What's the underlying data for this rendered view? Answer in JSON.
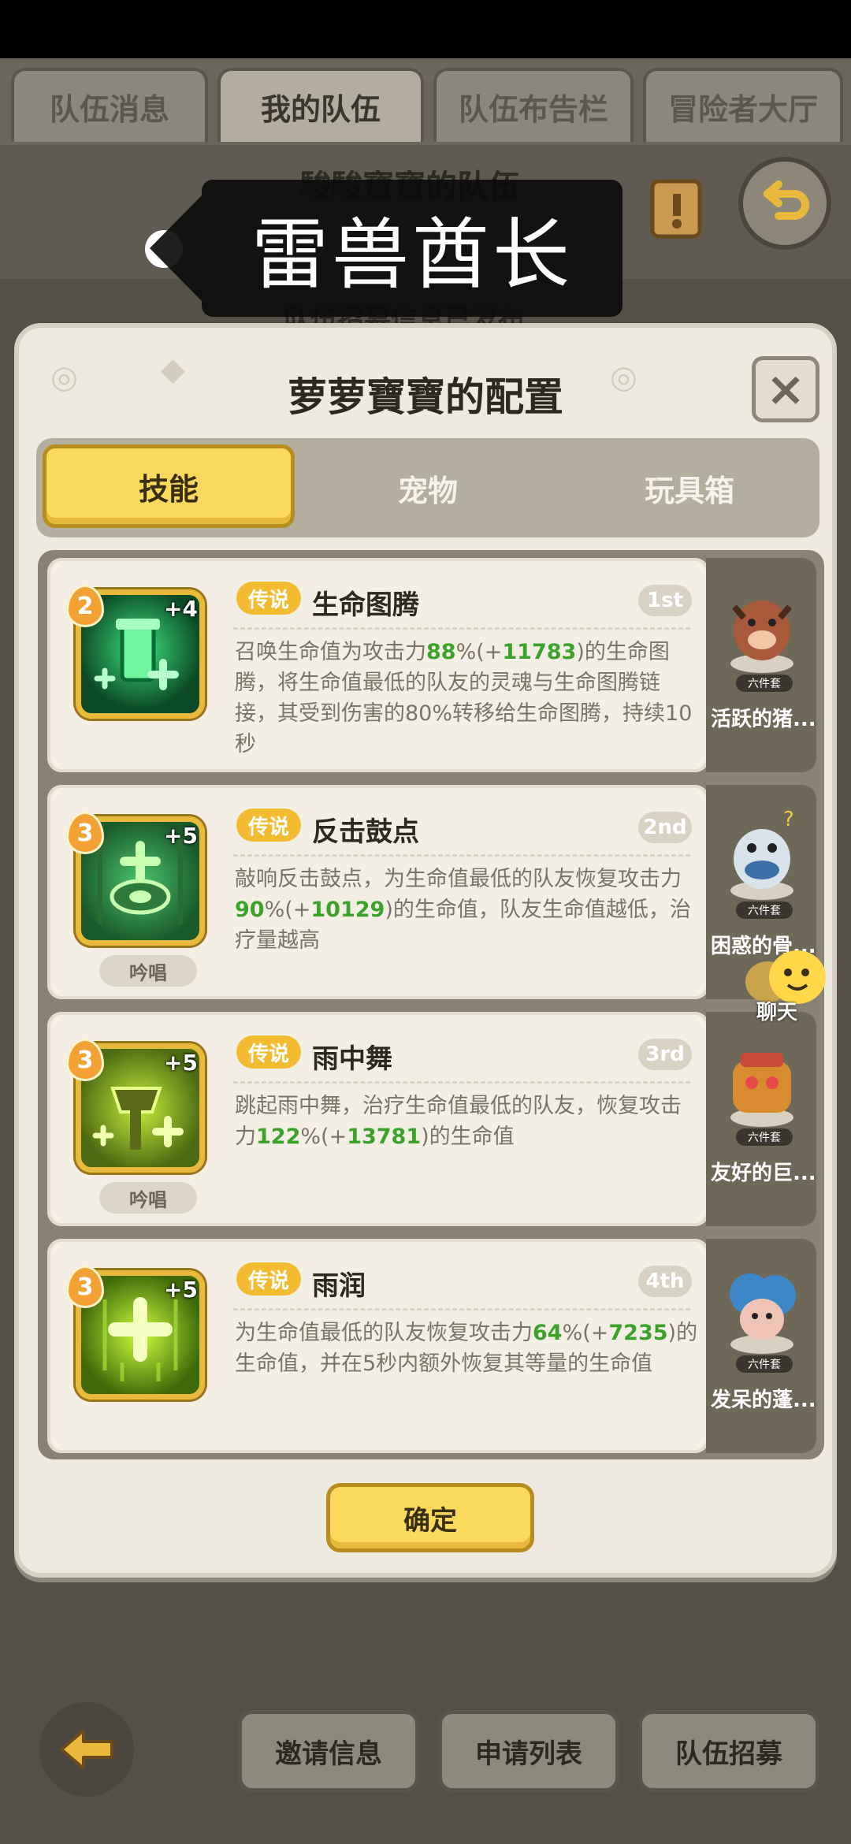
{
  "top_tabs": [
    "队伍消息",
    "我的队伍",
    "队伍布告栏",
    "冒险者大厅"
  ],
  "team_header": {
    "team_name": "駿駿寶寶的队伍",
    "recruit_status": "队伍招募信息已发布"
  },
  "speech_bubble": {
    "text": "雷兽酋长"
  },
  "modal": {
    "title": "萝萝寶寶的配置",
    "close_label": "×",
    "tabs": [
      "技能",
      "宠物",
      "玩具箱"
    ],
    "active_tab": "技能",
    "confirm_label": "确定"
  },
  "skills": [
    {
      "level": "2",
      "plus": "+4",
      "rarity": "传说",
      "name": "生命图腾",
      "rank": "1st",
      "tag": "",
      "desc_before": "召唤生命值为攻击力",
      "pct": "88",
      "pct_suffix": "%(+",
      "amount": "11783",
      "desc_after": ")的生命图腾，将生命值最低的队友的灵魂与生命图腾链接，其受到伤害的80%转移给生命图腾，持续10秒"
    },
    {
      "level": "3",
      "plus": "+5",
      "rarity": "传说",
      "name": "反击鼓点",
      "rank": "2nd",
      "tag": "吟唱",
      "desc_before": "敲响反击鼓点，为生命值最低的队友恢复攻击力",
      "pct": "90",
      "pct_suffix": "%(+",
      "amount": "10129",
      "desc_after": ")的生命值，队友生命值越低，治疗量越高"
    },
    {
      "level": "3",
      "plus": "+5",
      "rarity": "传说",
      "name": "雨中舞",
      "rank": "3rd",
      "tag": "吟唱",
      "desc_before": "跳起雨中舞，治疗生命值最低的队友，恢复攻击力",
      "pct": "122",
      "pct_suffix": "%(+",
      "amount": "13781",
      "desc_after": ")的生命值"
    },
    {
      "level": "3",
      "plus": "+5",
      "rarity": "传说",
      "name": "雨润",
      "rank": "4th",
      "tag": "",
      "desc_before": "为生命值最低的队友恢复攻击力",
      "pct": "64",
      "pct_suffix": "%(+",
      "amount": "7235",
      "desc_after": ")的生命值，并在5秒内额外恢复其等量的生命值"
    }
  ],
  "pets": [
    {
      "name": "活跃的猪...",
      "set": "六件套"
    },
    {
      "name": "困惑的骨...",
      "set": "六件套"
    },
    {
      "name": "友好的巨...",
      "set": "六件套"
    },
    {
      "name": "发呆的蓬...",
      "set": "六件套"
    }
  ],
  "chat": {
    "label": "聊天"
  },
  "bottom_buttons": [
    "邀请信息",
    "申请列表",
    "队伍招募"
  ],
  "colors": {
    "accent_yellow": "#fbd95c",
    "legend_orange": "#f3bb2f",
    "value_green": "#3ca32a",
    "icon_green": "#2ed46a"
  }
}
